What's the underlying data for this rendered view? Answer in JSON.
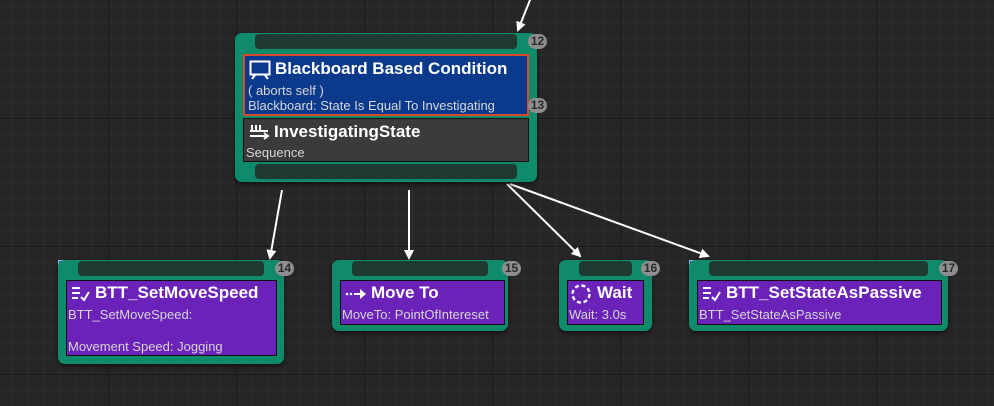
{
  "selector": {
    "index": "12",
    "decorator": {
      "title": "Blackboard Based Condition",
      "abort": "( aborts self )",
      "detail": "Blackboard: State Is Equal To Investigating",
      "index": "13"
    },
    "title": "InvestigatingState",
    "type": "Sequence"
  },
  "tasks": [
    {
      "index": "14",
      "title": "BTT_SetMoveSpeed",
      "line1": "BTT_SetMoveSpeed:",
      "line2": "Movement Speed: Jogging",
      "icon": "task-icon"
    },
    {
      "index": "15",
      "title": "Move To",
      "line1": "MoveTo: PointOfIntereset",
      "icon": "move-to-icon"
    },
    {
      "index": "16",
      "title": "Wait",
      "line1": "Wait: 3.0s",
      "icon": "wait-icon"
    },
    {
      "index": "17",
      "title": "BTT_SetStateAsPassive",
      "line1": "BTT_SetStateAsPassive",
      "icon": "task-icon"
    }
  ],
  "colors": {
    "node_border": "#0f8a6a",
    "task_body": "#6a22b8",
    "decorator_body": "#0b3a8c",
    "decorator_outline": "#d94a2c"
  }
}
